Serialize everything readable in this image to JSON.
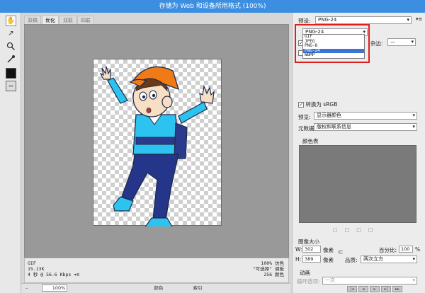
{
  "window": {
    "title": "存储为 Web 和设备所用格式 (100%)"
  },
  "tools": [
    {
      "name": "hand-tool-icon",
      "glyph": "✋"
    },
    {
      "name": "slice-select-tool-icon",
      "glyph": "↗"
    },
    {
      "name": "zoom-tool-icon",
      "glyph": "🔍"
    },
    {
      "name": "eyedropper-tool-icon",
      "glyph": "✎"
    }
  ],
  "tabs": [
    "原稿",
    "优化",
    "双联",
    "四联"
  ],
  "active_tab": 1,
  "canvas_info": {
    "left": [
      "GIF",
      "15.13K",
      "4 秒 @ 56.6 Kbps ▾≡"
    ],
    "right": [
      "100% 仿色",
      "\"可选择\" 调板",
      "256 颜色"
    ]
  },
  "bottom": {
    "zoom": "100%",
    "color_label": "颜色",
    "index_label": "索引"
  },
  "panel": {
    "preset_label": "预设:",
    "preset_value": "PNG-24",
    "format_value": "PNG-24",
    "format_options": [
      "GIF",
      "JPEG",
      "PNG-8",
      "PNG-24",
      "WBMP"
    ],
    "format_selected": 3,
    "matte_label": "杂边:",
    "matte_value": "—",
    "convert_srgb_label": "转换为 sRGB",
    "preview_label": "预览:",
    "preview_value": "显示器颜色",
    "metadata_label": "元数据:",
    "metadata_value": "版权和联系信息",
    "color_table_label": "颜色表",
    "image_size_label": "图像大小",
    "w_label": "W:",
    "w_value": "302",
    "h_label": "H:",
    "h_value": "389",
    "px_label": "像素",
    "percent_label": "百分比:",
    "percent_value": "100",
    "percent_unit": "%",
    "quality_label": "品质:",
    "quality_value": "两次立方",
    "animation_label": "动画",
    "loop_label": "循环选项:",
    "loop_value": "一次"
  },
  "colors": {
    "titlebar": "#3c8ee0",
    "highlight": "#3875d7",
    "annotation_red": "#e01e1e"
  }
}
